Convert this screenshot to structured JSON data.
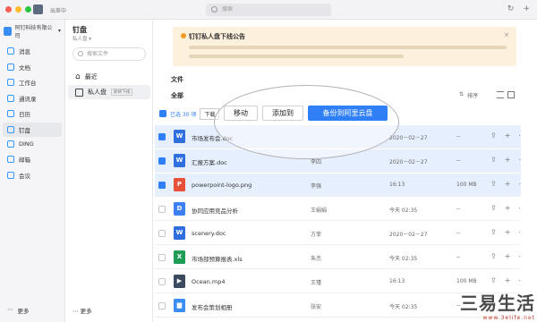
{
  "topbar": {
    "status": "出差中",
    "search_placeholder": "搜索",
    "icons": [
      "history-icon",
      "add-icon"
    ]
  },
  "org": {
    "name": "阿钉科技有限公司"
  },
  "nav": [
    {
      "label": "消息",
      "icon": "message-icon"
    },
    {
      "label": "文档",
      "icon": "doc-icon"
    },
    {
      "label": "工作台",
      "icon": "workbench-icon"
    },
    {
      "label": "通讯录",
      "icon": "contacts-icon"
    },
    {
      "label": "日历",
      "icon": "calendar-icon"
    },
    {
      "label": "钉盘",
      "icon": "drive-icon",
      "active": true
    },
    {
      "label": "DING",
      "icon": "ding-icon"
    },
    {
      "label": "邮箱",
      "icon": "mail-icon"
    },
    {
      "label": "会议",
      "icon": "meeting-icon"
    }
  ],
  "sidebar_more": "更多",
  "panel": {
    "title": "钉盘",
    "subtitle": "私人盘",
    "search_placeholder": "搜索文件",
    "recent": "最近",
    "private": "私人盘",
    "private_tag": "即将下线",
    "more": "更多"
  },
  "notice": {
    "title": "钉钉私人盘下线公告",
    "close": "×"
  },
  "main": {
    "section": "文件",
    "all": "全部",
    "sort_label": "排序",
    "selected": "已选 30 项",
    "download": "下载"
  },
  "actions": {
    "move": "移动",
    "add_to": "添加到",
    "backup": "备份到阿里云盘"
  },
  "files": [
    {
      "name": "市场发布会.doc",
      "owner": "",
      "date": "2020－02－27",
      "size": "--",
      "type": "W",
      "color": "#2f6fe0",
      "selected": true
    },
    {
      "name": "汇报方案.doc",
      "owner": "李四",
      "date": "2020－02－27",
      "size": "--",
      "type": "W",
      "color": "#2f6fe0",
      "selected": true
    },
    {
      "name": "powerpoint-logo.png",
      "owner": "李强",
      "date": "16:13",
      "size": "100 MB",
      "type": "P",
      "color": "#e8503a",
      "selected": true
    },
    {
      "name": "协同应用竞品分析",
      "owner": "王娟娟",
      "date": "今天 02:35",
      "size": "--",
      "type": "D",
      "color": "#3d7ff5",
      "selected": false
    },
    {
      "name": "scenery.doc",
      "owner": "方菲",
      "date": "2020－02－27",
      "size": "--",
      "type": "W",
      "color": "#2f6fe0",
      "selected": false
    },
    {
      "name": "市场部预算报表.xls",
      "owner": "朱杰",
      "date": "今天 02:35",
      "size": "--",
      "type": "X",
      "color": "#1f9d55",
      "selected": false
    },
    {
      "name": "Ocean.mp4",
      "owner": "王瑾",
      "date": "16:13",
      "size": "100 MB",
      "type": "▶",
      "color": "#3b4a5e",
      "selected": false
    },
    {
      "name": "发布会策划相册",
      "owner": "张安",
      "date": "今天 02:35",
      "size": "--",
      "type": "▆",
      "color": "#3a8ef3",
      "selected": false
    }
  ],
  "watermark": {
    "title": "三易生活",
    "url": "www.3elife.net"
  }
}
